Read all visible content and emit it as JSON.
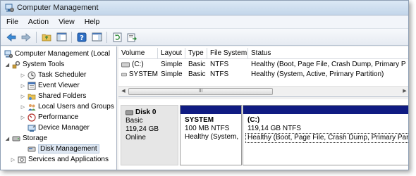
{
  "window": {
    "title": "Computer Management"
  },
  "menu": [
    "File",
    "Action",
    "View",
    "Help"
  ],
  "toolbar": [
    "back-icon",
    "forward-icon",
    "up-folder-icon",
    "show-hide-tree-icon",
    "help-icon",
    "properties-icon",
    "refresh-icon",
    "export-icon"
  ],
  "tree": {
    "root": "Computer Management (Local",
    "system_tools": "System Tools",
    "task_scheduler": "Task Scheduler",
    "event_viewer": "Event Viewer",
    "shared_folders": "Shared Folders",
    "local_users": "Local Users and Groups",
    "performance": "Performance",
    "device_manager": "Device Manager",
    "storage": "Storage",
    "disk_management": "Disk Management",
    "services": "Services and Applications"
  },
  "volumes": {
    "headers": [
      "Volume",
      "Layout",
      "Type",
      "File System",
      "Status"
    ],
    "rows": [
      [
        "(C:)",
        "Simple",
        "Basic",
        "NTFS",
        "Healthy (Boot, Page File, Crash Dump, Primary P"
      ],
      [
        "SYSTEM",
        "Simple",
        "Basic",
        "NTFS",
        "Healthy (System, Active, Primary Partition)"
      ]
    ],
    "scroll_grip": "III"
  },
  "disk": {
    "name": "Disk 0",
    "type": "Basic",
    "size": "119,24 GB",
    "status": "Online",
    "partitions": [
      {
        "name": "SYSTEM",
        "size": "100 MB NTFS",
        "status": "Healthy (System,"
      },
      {
        "name": "(C:)",
        "size": "119,14 GB NTFS",
        "status": "Healthy (Boot, Page File, Crash Dump, Primary Partition)"
      }
    ]
  },
  "colors": {
    "partition_bar": "#0f1b82",
    "titlebar": "#c3d6ea"
  }
}
